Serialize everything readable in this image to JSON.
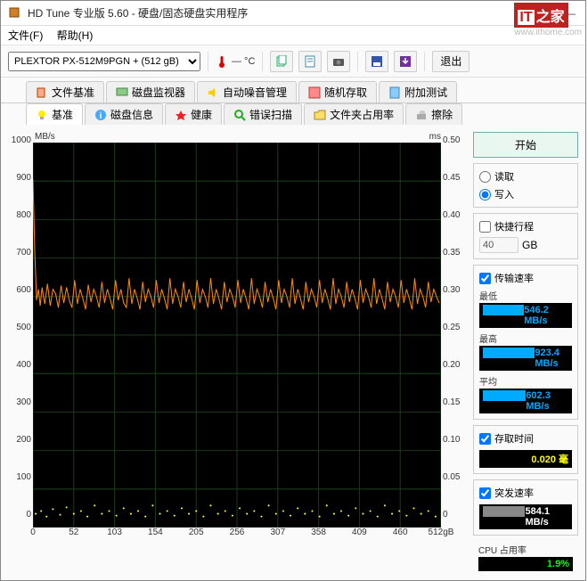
{
  "window": {
    "title": "HD Tune 专业版 5.60 - 硬盘/固态硬盘实用程序",
    "minimize": "—",
    "close": "×",
    "maximize": "□"
  },
  "watermark": {
    "brand_it": "IT",
    "brand_cn": "之家",
    "url": "www.ithome.com"
  },
  "menu": {
    "file": "文件(F)",
    "help": "帮助(H)"
  },
  "toolbar": {
    "drive": "PLEXTOR PX-512M9PGN  + (512 gB)",
    "temp_value": "— °C",
    "exit": "退出"
  },
  "tabs_top": [
    {
      "label": "文件基准"
    },
    {
      "label": "磁盘监视器"
    },
    {
      "label": "自动噪音管理"
    },
    {
      "label": "随机存取"
    },
    {
      "label": "附加测试"
    }
  ],
  "tabs_bottom": [
    {
      "label": "基准",
      "active": true
    },
    {
      "label": "磁盘信息"
    },
    {
      "label": "健康"
    },
    {
      "label": "错误扫描"
    },
    {
      "label": "文件夹占用率"
    },
    {
      "label": "擦除"
    }
  ],
  "chart": {
    "y_left_unit": "MB/s",
    "y_right_unit": "ms",
    "y_left_ticks": [
      "1000",
      "900",
      "800",
      "700",
      "600",
      "500",
      "400",
      "300",
      "200",
      "100",
      "0"
    ],
    "y_right_ticks": [
      "0.50",
      "0.45",
      "0.40",
      "0.35",
      "0.30",
      "0.25",
      "0.20",
      "0.15",
      "0.10",
      "0.05",
      "0"
    ],
    "x_ticks": [
      "0",
      "52",
      "103",
      "154",
      "205",
      "256",
      "307",
      "358",
      "409",
      "460",
      "512gB"
    ]
  },
  "chart_data": {
    "type": "line+scatter",
    "x_range_gb": [
      0,
      512
    ],
    "transfer_rate_series": {
      "unit": "MB/s",
      "ylim": [
        0,
        1000
      ],
      "min": 546.2,
      "max": 923.4,
      "avg": 602.3,
      "approx_baseline": 600,
      "approx_amplitude_low": 540,
      "approx_amplitude_high": 660,
      "initial_spike_mb_s": 900
    },
    "access_time_series": {
      "unit": "ms",
      "ylim": [
        0,
        0.5
      ],
      "avg": 0.02,
      "approx_band_low": 0.01,
      "approx_band_high": 0.04
    },
    "burst_rate_mb_s": 584.1,
    "cpu_usage_pct": 1.9
  },
  "side": {
    "start": "开始",
    "read": "读取",
    "write": "写入",
    "shortstroke": "快捷行程",
    "shortstroke_val": "40",
    "shortstroke_unit": "GB",
    "transfer": "传输速率",
    "min_label": "最低",
    "min_val": "546.2 MB/s",
    "max_label": "最高",
    "max_val": "923.4 MB/s",
    "avg_label": "平均",
    "avg_val": "602.3 MB/s",
    "access": "存取时间",
    "access_val": "0.020 毫",
    "burst": "突发速率",
    "burst_val": "584.1 MB/s",
    "cpu": "CPU 占用率",
    "cpu_val": "1.9%"
  }
}
